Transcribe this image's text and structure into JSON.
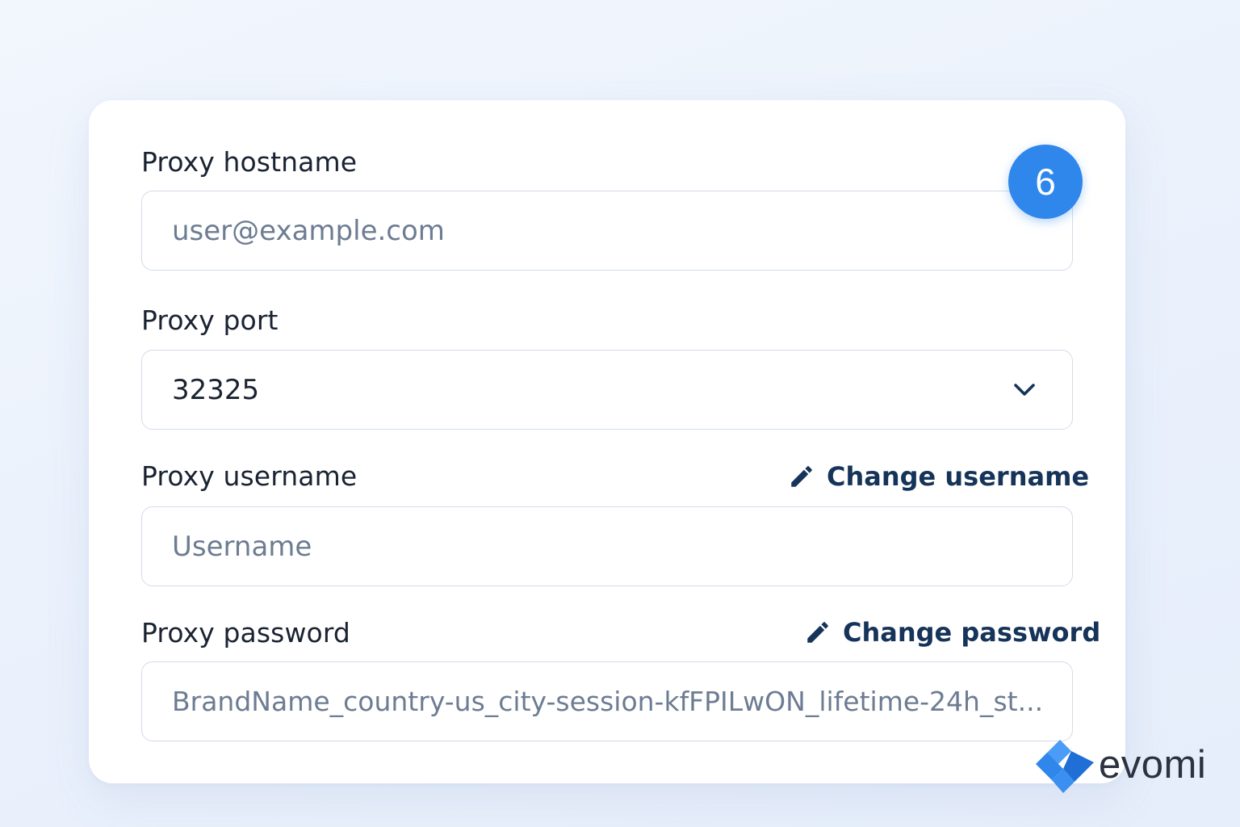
{
  "form": {
    "hostname": {
      "label": "Proxy hostname",
      "placeholder": "user@example.com",
      "value": ""
    },
    "port": {
      "label": "Proxy port",
      "selected_value": "32325"
    },
    "username": {
      "label": "Proxy username",
      "placeholder": "Username",
      "value": "",
      "change_label": "Change username"
    },
    "password": {
      "label": "Proxy password",
      "value": "BrandName_country-us_city-session-kfFPILwON_lifetime-24h_st...",
      "change_label": "Change password"
    }
  },
  "step_badge": "6",
  "brand": {
    "name": "evomi"
  },
  "icons": {
    "chevron": "chevron-down-icon",
    "pencil": "pencil-icon",
    "logo": "evomi-logo-icon"
  },
  "colors": {
    "background": "#eaf1fc",
    "card": "#ffffff",
    "text": "#1a2332",
    "placeholder": "#6d7c92",
    "link": "#163359",
    "badge": "#2f86eb",
    "input_border": "#d3dce8"
  }
}
